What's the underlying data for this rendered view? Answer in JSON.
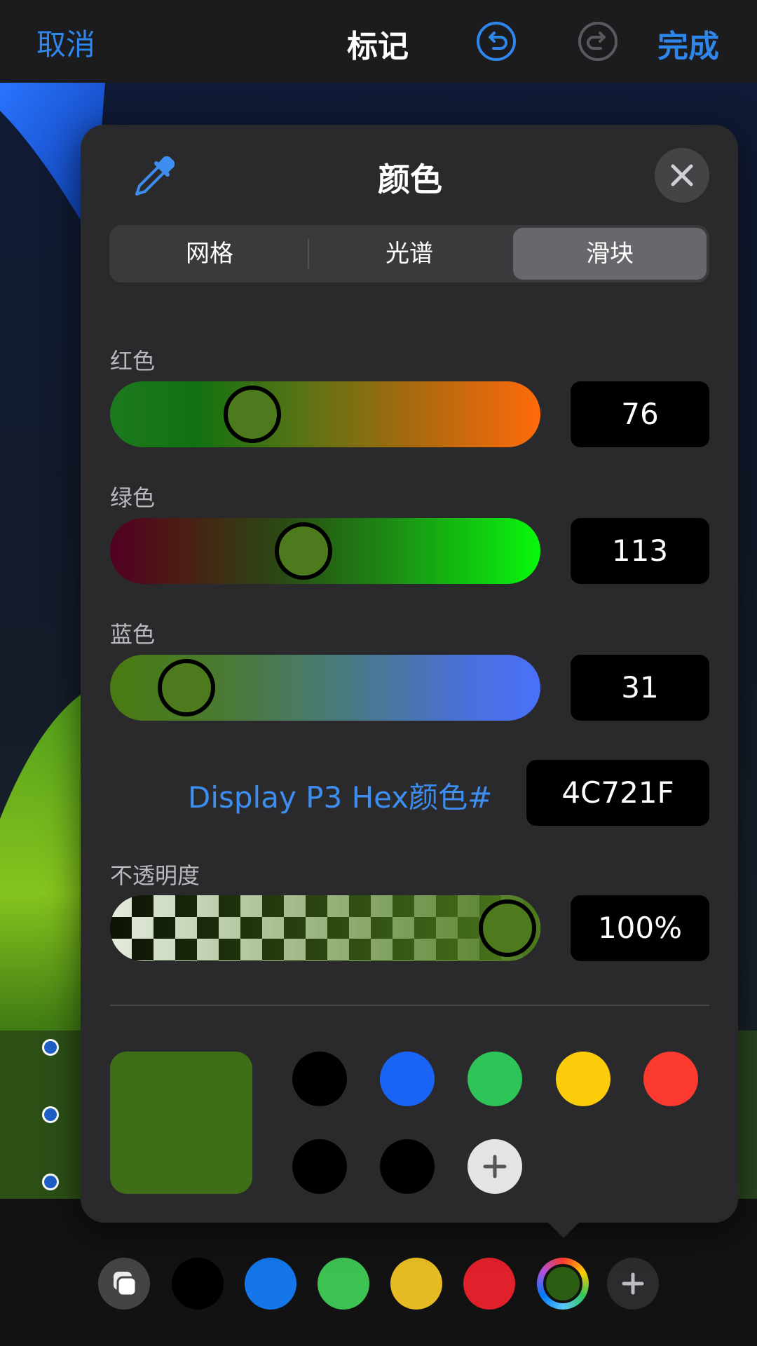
{
  "topbar": {
    "cancel": "取消",
    "title": "标记",
    "done": "完成",
    "accent": "#2f86ec"
  },
  "popover": {
    "title": "颜色",
    "tabs": [
      {
        "label": "网格",
        "active": false
      },
      {
        "label": "光谱",
        "active": false
      },
      {
        "label": "滑块",
        "active": true
      }
    ],
    "sliders": {
      "red": {
        "label": "红色",
        "value": "76",
        "fraction": 0.3
      },
      "green": {
        "label": "绿色",
        "value": "113",
        "fraction": 0.44
      },
      "blue": {
        "label": "蓝色",
        "value": "31",
        "fraction": 0.12
      }
    },
    "hex": {
      "label": "Display P3 Hex颜色#",
      "value": "4C721F"
    },
    "opacity": {
      "label": "不透明度",
      "value": "100%",
      "fraction": 1.0
    },
    "current_color": "#3e6e18",
    "swatches": [
      "#000000",
      "#1a64f5",
      "#2fc457",
      "#fccb0a",
      "#fd3a30",
      "#000000",
      "#000000"
    ]
  },
  "bottom_palette": {
    "colors": [
      "#000000",
      "#1476e8",
      "#3ec153",
      "#e7bb23",
      "#e0212b"
    ],
    "selected": "#2b5e12"
  }
}
